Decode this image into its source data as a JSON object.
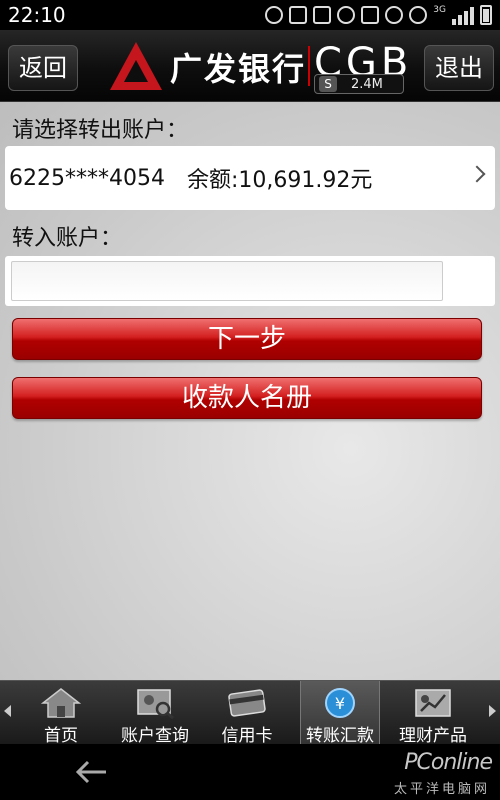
{
  "status_bar": {
    "time": "22:10",
    "network": "3G"
  },
  "header": {
    "back_label": "返回",
    "exit_label": "退出",
    "brand_cn": "广发银行",
    "brand_en": "CGB",
    "speed_badge": "S",
    "speed": "2.4M"
  },
  "main": {
    "select_from_label": "请选择转出账户：",
    "account_number": "6225****4054",
    "balance": "余额:10,691.92元",
    "to_account_label": "转入账户：",
    "to_account_value": "",
    "next_button": "下一步",
    "payee_button": "收款人名册"
  },
  "tabs": [
    {
      "label": "首页",
      "icon": "home-icon"
    },
    {
      "label": "账户查询",
      "icon": "account-query-icon"
    },
    {
      "label": "信用卡",
      "icon": "credit-card-icon"
    },
    {
      "label": "转账汇款",
      "icon": "transfer-icon",
      "active": true
    },
    {
      "label": "理财产品",
      "icon": "finance-chart-icon"
    }
  ],
  "watermark": {
    "top": "PConline",
    "bottom": "太平洋电脑网"
  },
  "colors": {
    "brand_red": "#c4161c",
    "button_red": "#c01818",
    "header_black": "#0e0e0e"
  }
}
